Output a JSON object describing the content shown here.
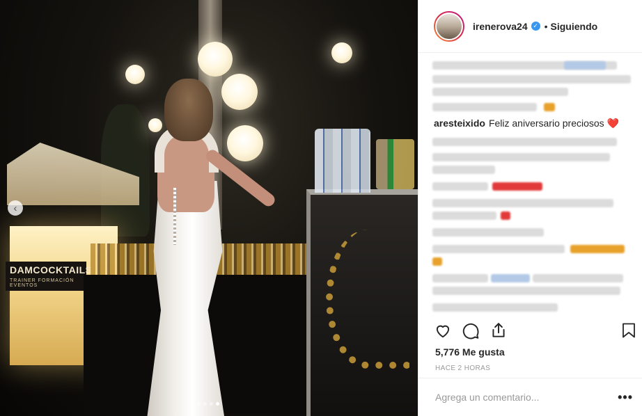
{
  "photo": {
    "sign_brand": "DAMCOCKTAILS",
    "sign_sub": "TRAINER  FORMACIÓN  EVENTOS",
    "prev_icon": "chevron-left-icon",
    "carousel_total": 4,
    "carousel_active": 4
  },
  "post_header": {
    "username": "irenerova24",
    "verified_icon": "verified-badge-icon",
    "separator": "•",
    "follow_status": "Siguiendo"
  },
  "comments": {
    "visible_comment": {
      "username": "aresteixido",
      "text": "Feliz aniversario preciosos ❤️"
    }
  },
  "actions": {
    "icons": [
      "heart-icon",
      "comment-icon",
      "share-icon",
      "bookmark-icon"
    ]
  },
  "likes_text": "5,776 Me gusta",
  "timestamp": "HACE 2 HORAS",
  "add_comment": {
    "placeholder": "Agrega un comentario...",
    "more_label": "•••"
  },
  "colors": {
    "accent": "#3897f0",
    "text": "#262626",
    "muted": "#999999",
    "divider": "#efefef"
  }
}
